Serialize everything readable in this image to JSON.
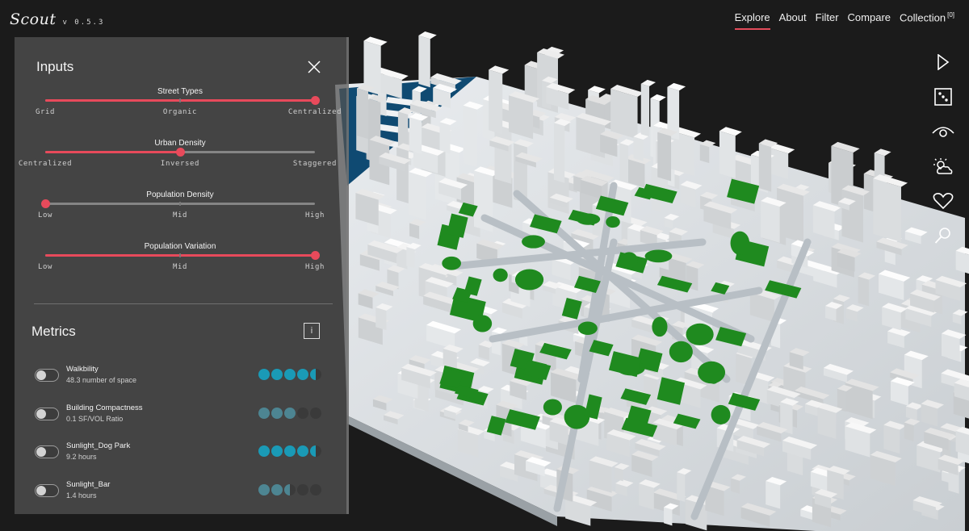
{
  "app": {
    "logo_text": "Scout",
    "version": "v 0.5.3"
  },
  "nav": [
    {
      "label": "Explore",
      "active": true
    },
    {
      "label": "About",
      "active": false
    },
    {
      "label": "Filter",
      "active": false
    },
    {
      "label": "Compare",
      "active": false
    },
    {
      "label": "Collection",
      "active": false,
      "badge": "[0]"
    }
  ],
  "toolbar": [
    {
      "icon": "play-icon"
    },
    {
      "icon": "dice-icon"
    },
    {
      "icon": "eye-icon"
    },
    {
      "icon": "weather-icon"
    },
    {
      "icon": "heart-icon"
    },
    {
      "icon": "search-icon"
    }
  ],
  "inputs": {
    "title": "Inputs",
    "sliders": [
      {
        "label": "Street Types",
        "value": 1.0,
        "ticks": [
          "Grid",
          "Organic",
          "Centralized"
        ]
      },
      {
        "label": "Urban Density",
        "value": 0.5,
        "ticks": [
          "Centralized",
          "Inversed",
          "Staggered"
        ]
      },
      {
        "label": "Population Density",
        "value": 0.0,
        "ticks": [
          "Low",
          "Mid",
          "High"
        ]
      },
      {
        "label": "Population Variation",
        "value": 1.0,
        "ticks": [
          "Low",
          "Mid",
          "High"
        ]
      }
    ]
  },
  "metrics": {
    "title": "Metrics",
    "info_label": "i",
    "items": [
      {
        "name": "Walkbility",
        "value": "48.3 number of space",
        "score": 4.5,
        "color": "#1a9ab6"
      },
      {
        "name": "Building Compactness",
        "value": "0.1 SF/VOL Ratio",
        "score": 3.0,
        "color": "#4d8592"
      },
      {
        "name": "Sunlight_Dog Park",
        "value": "9.2 hours",
        "score": 4.5,
        "color": "#1a9ab6"
      },
      {
        "name": "Sunlight_Bar",
        "value": "1.4 hours",
        "score": 2.5,
        "color": "#4d8592"
      }
    ]
  },
  "colors": {
    "accent": "#e84a5b",
    "park": "#1f8a1f",
    "water": "#0f4a72"
  }
}
